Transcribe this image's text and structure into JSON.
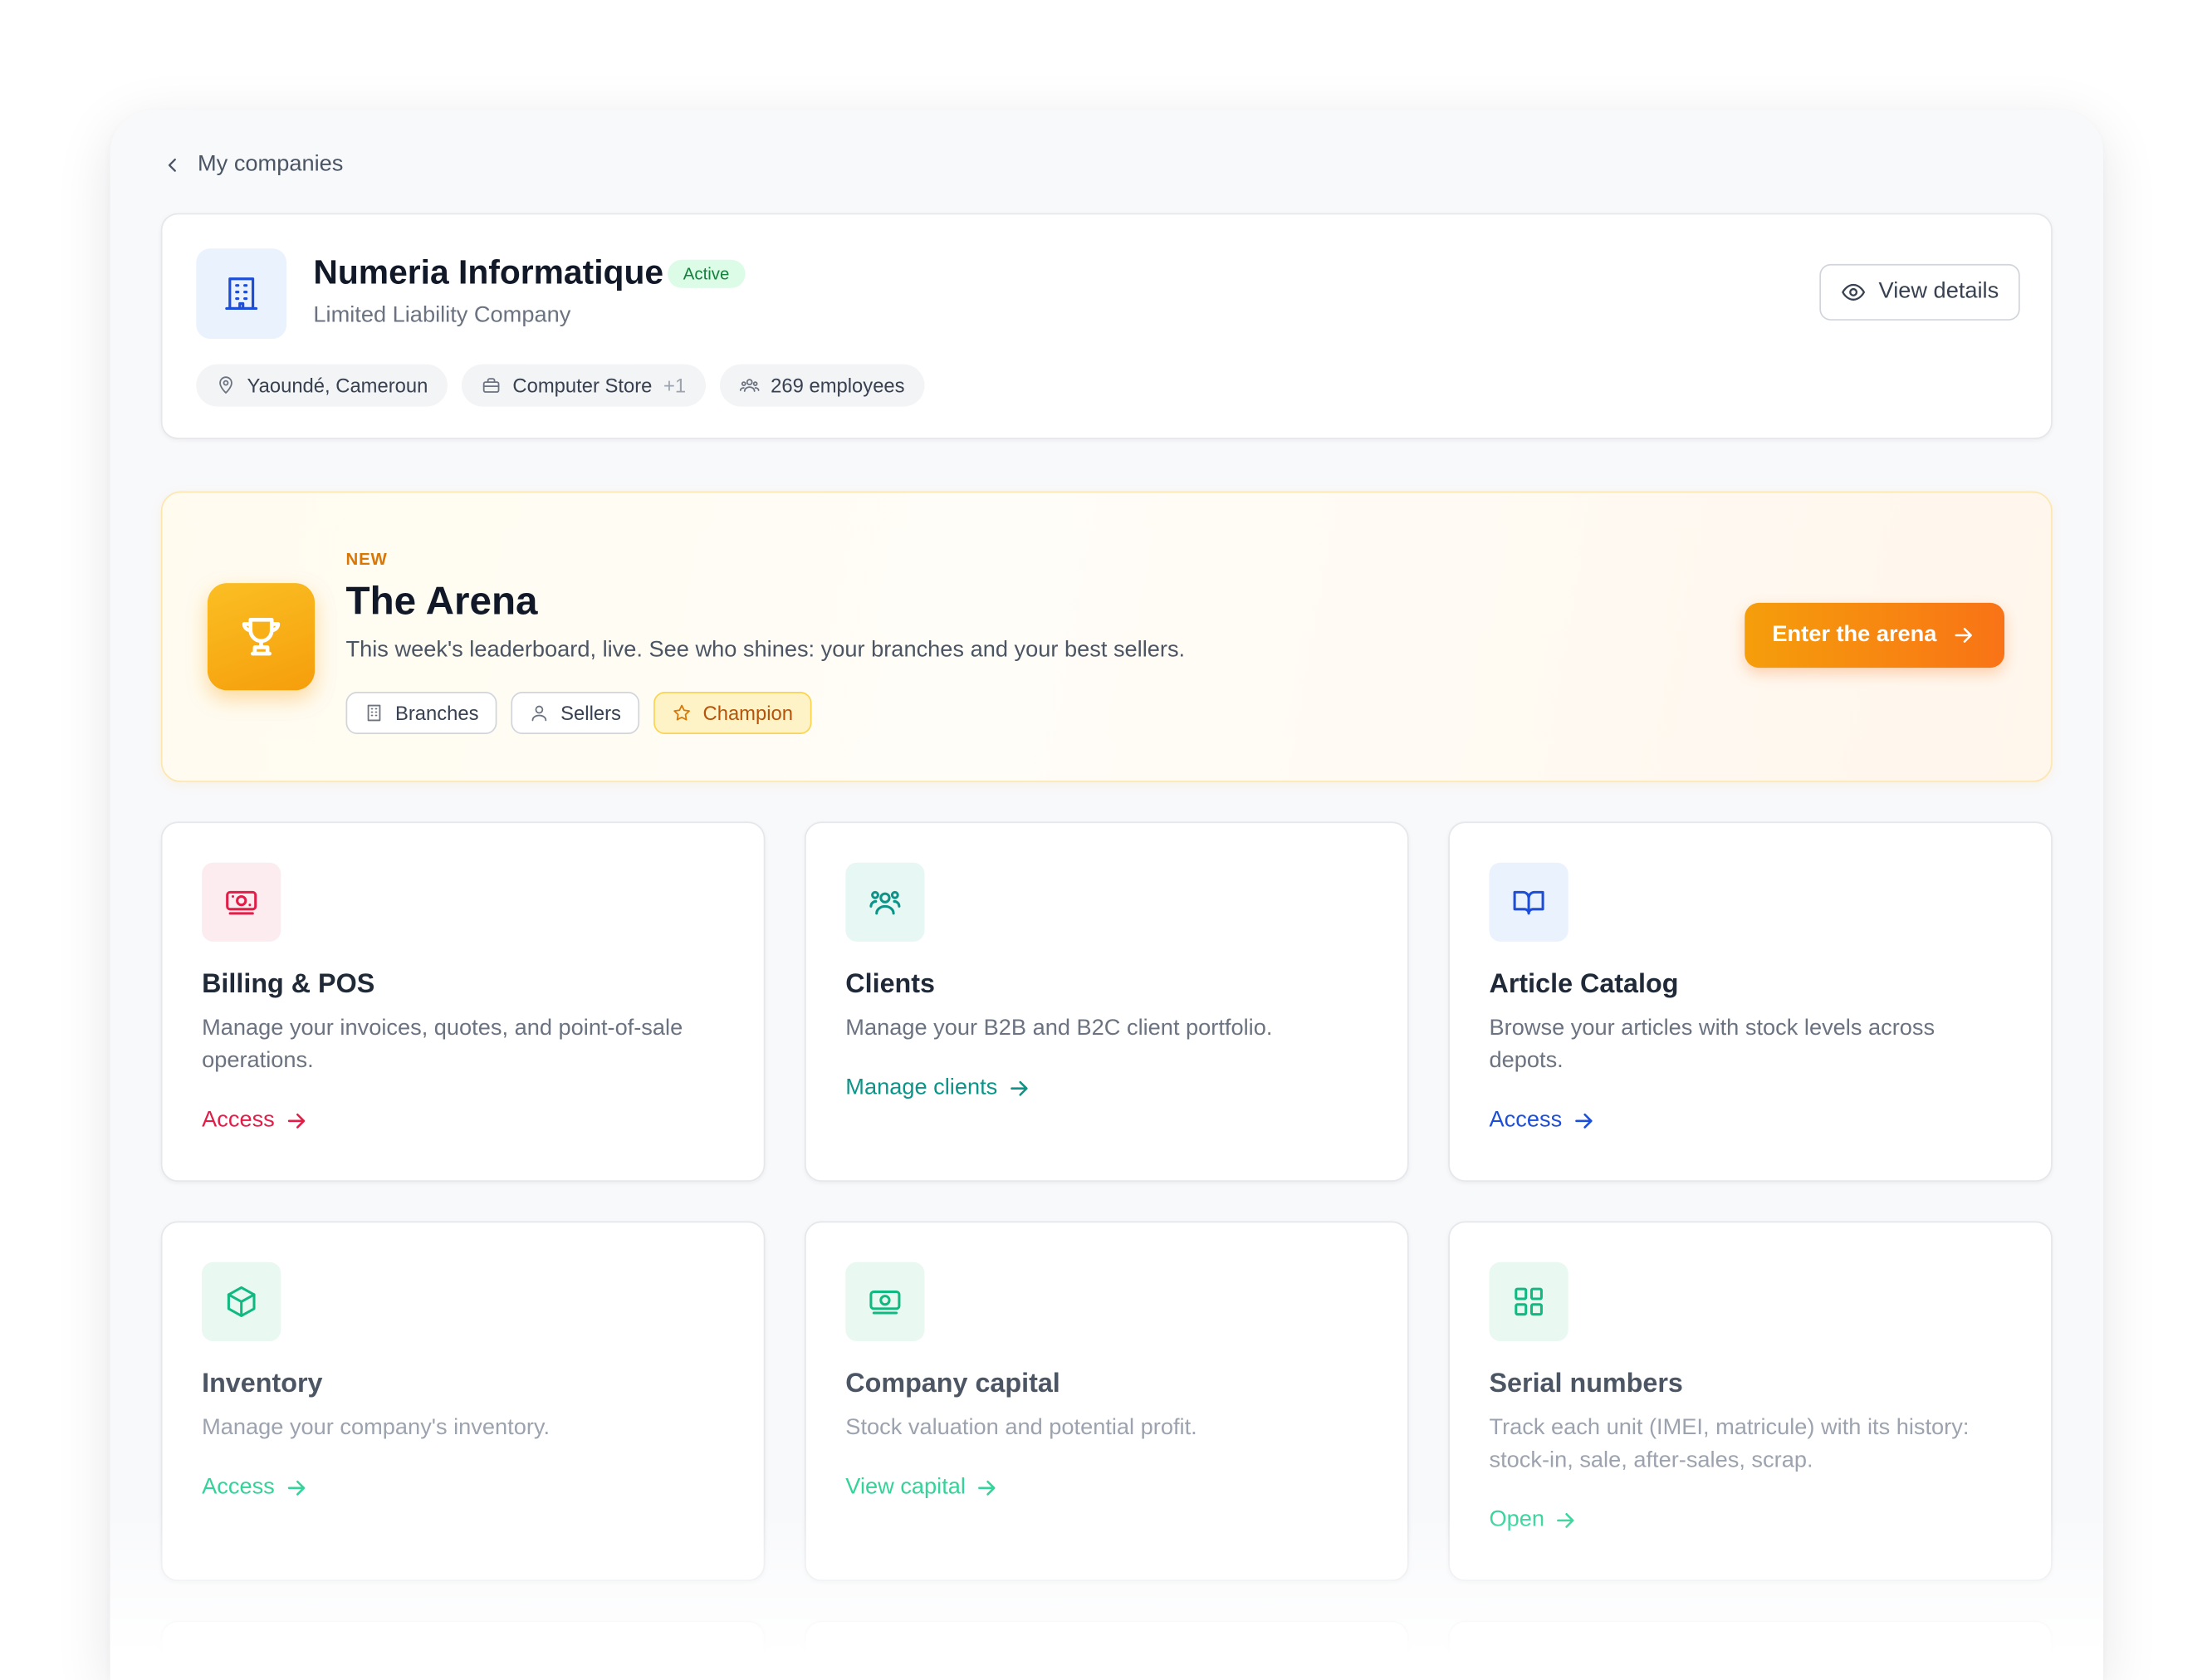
{
  "breadcrumb": {
    "back_label": "My companies"
  },
  "company": {
    "name": "Numeria Informatique",
    "status": "Active",
    "type": "Limited Liability Company",
    "view_details_label": "View details",
    "location": "Yaoundé, Cameroun",
    "store": "Computer Store",
    "store_extra": "+1",
    "employees": "269 employees"
  },
  "arena": {
    "badge": "NEW",
    "title": "The Arena",
    "subtitle": "This week's leaderboard, live. See who shines: your branches and your best sellers.",
    "tags": [
      "Branches",
      "Sellers",
      "Champion"
    ],
    "cta_label": "Enter the arena"
  },
  "modules": [
    {
      "title": "Billing & POS",
      "description": "Manage your invoices, quotes, and point-of-sale operations.",
      "link": "Access",
      "color": "#e11d48",
      "icon": "money-icon"
    },
    {
      "title": "Clients",
      "description": "Manage your B2B and B2C client portfolio.",
      "link": "Manage clients",
      "color": "#0d9488",
      "icon": "users-icon"
    },
    {
      "title": "Article Catalog",
      "description": "Browse your articles with stock levels across depots.",
      "link": "Access",
      "color": "#1d4ed8",
      "icon": "book-icon"
    },
    {
      "title": "Inventory",
      "description": "Manage your company's inventory.",
      "link": "Access",
      "color": "#34d399",
      "icon": "box-icon"
    },
    {
      "title": "Company capital",
      "description": "Stock valuation and potential profit.",
      "link": "View capital",
      "color": "#34d399",
      "icon": "money-icon"
    },
    {
      "title": "Serial numbers",
      "description": "Track each unit (IMEI, matricule) with its history: stock-in, sale, after-sales, scrap.",
      "link": "Open",
      "color": "#34d399",
      "icon": "grid-icon"
    }
  ],
  "colors": {
    "accent": "#f59e0b",
    "active_badge": "#dcfce7",
    "primary_blue": "#1d4ed8"
  }
}
